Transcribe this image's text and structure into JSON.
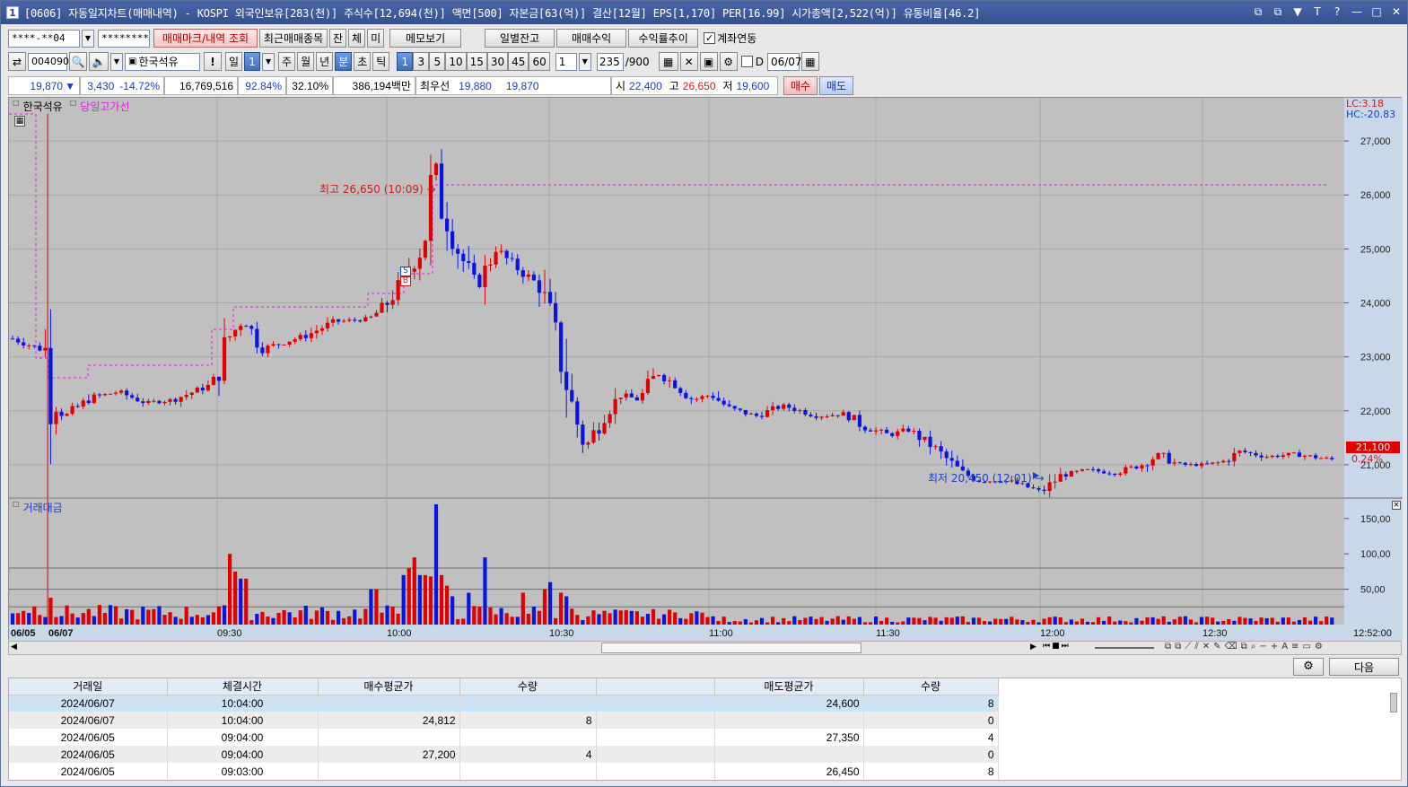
{
  "window": {
    "number_badge": "1",
    "title": "[0606] 자동일지차트(매매내역) - KOSPI 외국인보유[283(천)] 주식수[12,694(천)] 액면[500] 자본금[63(억)] 결산[12월] EPS[1,170] PER[16.99] 시가총액[2,522(억)] 유통비율[46.2]",
    "controls": [
      "⧉",
      "⧉",
      "▼",
      "T",
      "?",
      "—",
      "□",
      "✕"
    ]
  },
  "toolbar1": {
    "account": "****-**04",
    "password": "********",
    "trade_mark_btn": "매매마크/내역 조회",
    "recent_btn": "최근매매종목",
    "jan": "잔",
    "che": "체",
    "mi": "미",
    "memo_btn": "메모보기",
    "daily_balance_btn": "일별잔고",
    "trade_profit_btn": "매매수익",
    "profit_trend_btn": "수익률추이",
    "account_link_label": "계좌연동",
    "account_link_checked": true
  },
  "toolbar2": {
    "code": "004090",
    "stock_name": "한국석유",
    "alert": "!",
    "period_il": "일",
    "period_num": "1",
    "ju": "주",
    "wol": "월",
    "nyeon": "년",
    "bun": "분",
    "cho": "초",
    "tik": "틱",
    "intervals": [
      "1",
      "3",
      "5",
      "10",
      "15",
      "30",
      "45",
      "60"
    ],
    "interval_selected": "1",
    "multiplier": "1",
    "count": "235",
    "count_max": "/900",
    "d_label": "D",
    "date": "06/07"
  },
  "infobar": {
    "price": "19,870",
    "down_arrow": "▼",
    "change": "3,430",
    "change_pct": "-14.72%",
    "volume": "16,769,516",
    "pct1": "92.84%",
    "pct2": "32.10%",
    "amount": "386,194백만",
    "best_bid_label": "최우선",
    "best_ask": "19,880",
    "best_bid": "19,870",
    "open_label": "시",
    "open": "22,400",
    "high_label": "고",
    "high": "26,650",
    "low_label": "저",
    "low": "19,600",
    "buy_btn": "매수",
    "sell_btn": "매도"
  },
  "chart": {
    "legend_stock": "한국석유",
    "legend_line": "당일고가선",
    "lc_label": "LC:3.18",
    "hc_label": "HC:-20.83",
    "current_price_tag": "21,100",
    "current_pct_tag": "0.24%",
    "high_annotation": "최고 26,650 (10:09) →",
    "low_annotation": "최저 20,450 (12:01) →",
    "buy_marker": "B",
    "sell_marker": "S",
    "volume_legend": "거래대금",
    "time_labels": [
      "06/05",
      "06/07",
      "09:30",
      "10:00",
      "10:30",
      "11:00",
      "11:30",
      "12:00",
      "12:30",
      "12:52:00"
    ]
  },
  "chart_data": {
    "type": "candlestick",
    "price_axis_ticks": [
      "27,000",
      "26,000",
      "25,000",
      "24,000",
      "23,000",
      "22,000",
      "21,000"
    ],
    "volume_axis_ticks": [
      "150,00",
      "100,00",
      "50,00"
    ],
    "ylim": [
      20400,
      27800
    ],
    "day_high": 26650,
    "day_low": 20450,
    "current": 21100
  },
  "grid": {
    "columns": [
      "거래일",
      "체결시간",
      "매수평균가",
      "수량",
      "",
      "매도평균가",
      "수량"
    ],
    "rows": [
      [
        "2024/06/07",
        "10:04:00",
        "",
        "",
        "",
        "24,600",
        "8"
      ],
      [
        "2024/06/07",
        "10:04:00",
        "24,812",
        "8",
        "",
        "",
        "0"
      ],
      [
        "2024/06/05",
        "09:04:00",
        "",
        "",
        "",
        "27,350",
        "4"
      ],
      [
        "2024/06/05",
        "09:04:00",
        "27,200",
        "4",
        "",
        "",
        "0"
      ],
      [
        "2024/06/05",
        "09:03:00",
        "",
        "",
        "",
        "26,450",
        "8"
      ]
    ],
    "next_btn": "다음"
  }
}
